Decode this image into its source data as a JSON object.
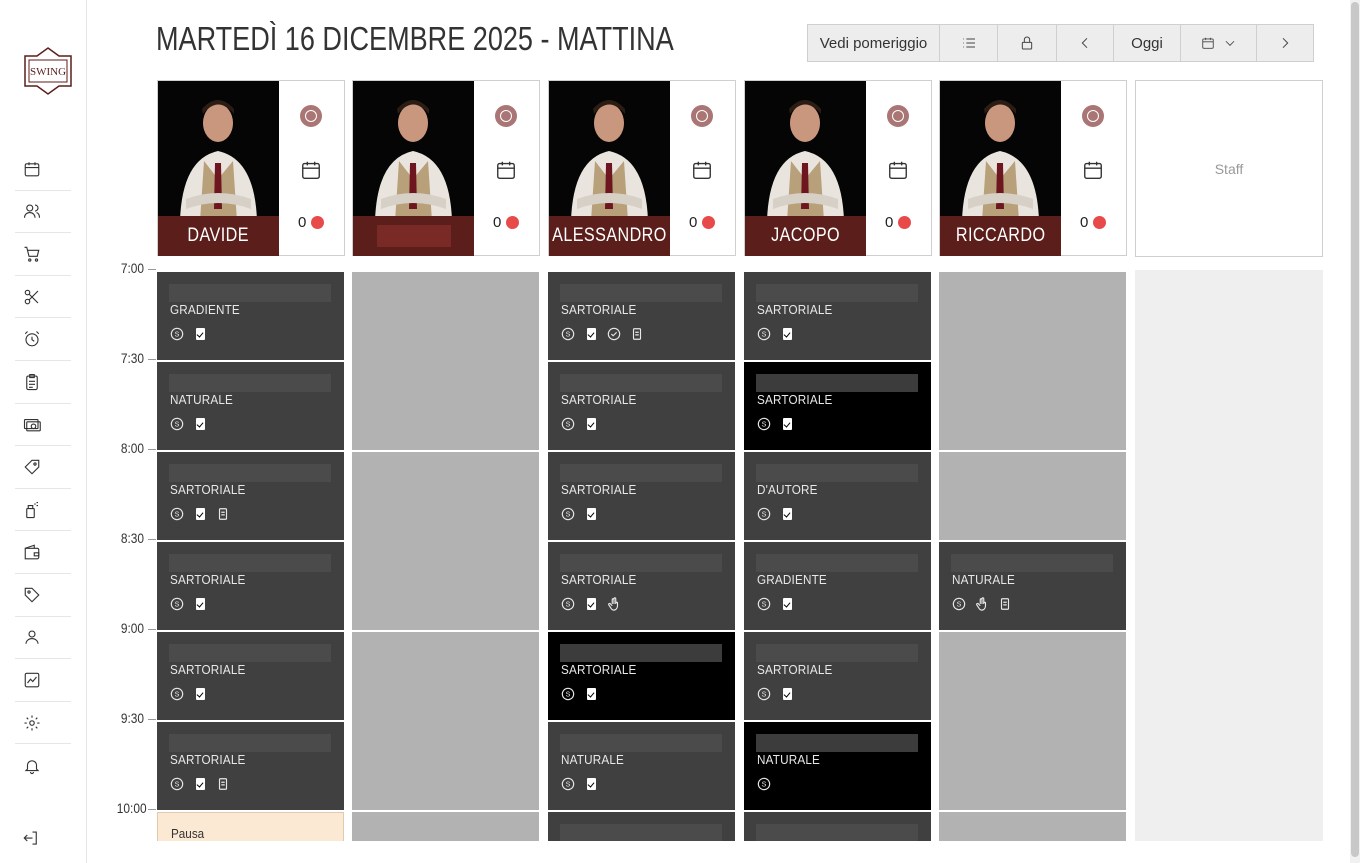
{
  "header": {
    "title": "MARTEDÌ 16 DICEMBRE 2025 - MATTINA",
    "afternoon_label": "Vedi pomeriggio",
    "today_label": "Oggi"
  },
  "sidebar": {
    "logo_text": "SWING",
    "items": [
      "calendar-icon",
      "users-icon",
      "cart-icon",
      "scissors-icon",
      "alarm-icon",
      "clipboard-icon",
      "cash-icon",
      "ticket-icon",
      "spray-icon",
      "wallet-icon",
      "tag-icon",
      "user-icon",
      "chart-icon",
      "gear-icon",
      "bell-icon"
    ],
    "logout_icon": "logout-icon"
  },
  "staff": [
    {
      "name": "DAVIDE",
      "count": "0"
    },
    {
      "name": "",
      "count": "0"
    },
    {
      "name": "ALESSANDRO",
      "count": "0"
    },
    {
      "name": "JACOPO",
      "count": "0"
    },
    {
      "name": "RICCARDO",
      "count": "0"
    }
  ],
  "staff_placeholder": "Staff",
  "times": [
    "7:00",
    "7:30",
    "8:00",
    "8:30",
    "9:00",
    "9:30",
    "10:00"
  ],
  "colors": {
    "brand": "#5b1e1a",
    "appointment": "#404040",
    "unavailable": "#b2b2b2",
    "break": "#fbe9d4",
    "status_dot": "#e84a4a"
  },
  "appointments": {
    "davide": [
      "GRADIENTE",
      "NATURALE",
      "SARTORIALE",
      "SARTORIALE",
      "SARTORIALE",
      "SARTORIALE"
    ],
    "alessandro": [
      "SARTORIALE",
      "SARTORIALE",
      "SARTORIALE",
      "SARTORIALE",
      "SARTORIALE",
      "NATURALE"
    ],
    "jacopo": [
      "SARTORIALE",
      "SARTORIALE",
      "D'AUTORE",
      "GRADIENTE",
      "SARTORIALE",
      "NATURALE"
    ],
    "riccardo": [
      "NATURALE"
    ]
  },
  "break_label": "Pausa"
}
